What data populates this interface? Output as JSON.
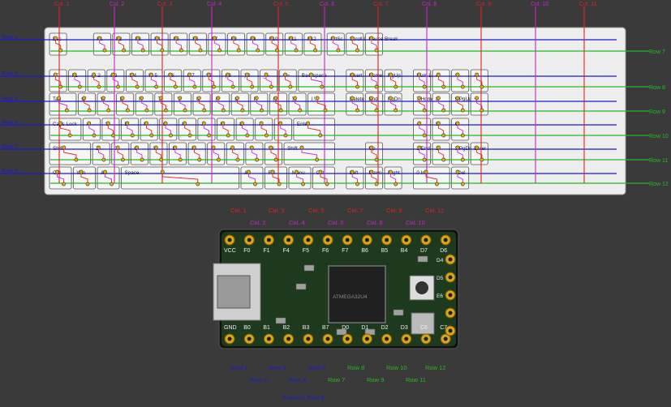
{
  "colors": {
    "background": "#3a3a3a",
    "red": "#e02020",
    "magenta": "#cc22cc",
    "blue": "#1a1acc",
    "green": "#22bb22",
    "keyboard_bg": "#eeeeee",
    "key_fill": "#f6f6f6",
    "key_border": "#555555",
    "pcb": "#111111",
    "pad_gold": "#d9a520"
  },
  "rows_left": [
    "Row 1",
    "Row 2",
    "Row 3",
    "Row 4",
    "Row 5",
    "Row 6"
  ],
  "rows_right": [
    "Row 7",
    "Row 8",
    "Row 9",
    "Row 10",
    "Row 11",
    "Row 12"
  ],
  "cols_top": [
    "Col. 1",
    "Col. 2",
    "Col. 3",
    "Col. 4",
    "Col. 5",
    "Col. 6",
    "Col. 7",
    "Col. 8",
    "Col. 9",
    "Col. 10",
    "Col. 11"
  ],
  "keys": [
    {
      "text": "Esc"
    },
    {
      "text": "F1"
    },
    {
      "text": "F2"
    },
    {
      "text": "F3"
    },
    {
      "text": "F4"
    },
    {
      "text": "F5"
    },
    {
      "text": "F6"
    },
    {
      "text": "F7"
    },
    {
      "text": "F8"
    },
    {
      "text": "F9"
    },
    {
      "text": "F10"
    },
    {
      "text": "F11"
    },
    {
      "text": "F12"
    },
    {
      "text": "PrtSc"
    },
    {
      "text": "Scroll Lock"
    },
    {
      "text": "Pause Break"
    },
    {
      "text": "~ `"
    },
    {
      "text": "! 1"
    },
    {
      "text": "@ 2"
    },
    {
      "text": "# 3"
    },
    {
      "text": "$ 4"
    },
    {
      "text": "% 5"
    },
    {
      "text": "^ 6"
    },
    {
      "text": "& 7"
    },
    {
      "text": "* 8"
    },
    {
      "text": "( 9"
    },
    {
      "text": ") 0"
    },
    {
      "text": "_ -"
    },
    {
      "text": "+ ="
    },
    {
      "text": "Backspace"
    },
    {
      "text": "Insert"
    },
    {
      "text": "Home"
    },
    {
      "text": "PgUp"
    },
    {
      "text": "Num Lock"
    },
    {
      "text": "/"
    },
    {
      "text": "*"
    },
    {
      "text": "-"
    },
    {
      "text": "Tab"
    },
    {
      "text": "Q"
    },
    {
      "text": "W"
    },
    {
      "text": "E"
    },
    {
      "text": "R"
    },
    {
      "text": "T"
    },
    {
      "text": "Y"
    },
    {
      "text": "U"
    },
    {
      "text": "I"
    },
    {
      "text": "O"
    },
    {
      "text": "P"
    },
    {
      "text": "{ ["
    },
    {
      "text": "} ]"
    },
    {
      "text": "| \\"
    },
    {
      "text": "Delete"
    },
    {
      "text": "End"
    },
    {
      "text": "PgDn"
    },
    {
      "text": "7 Home"
    },
    {
      "text": "8"
    },
    {
      "text": "9 PgUp"
    },
    {
      "text": "+"
    },
    {
      "text": "Caps Lock"
    },
    {
      "text": "A"
    },
    {
      "text": "S"
    },
    {
      "text": "D"
    },
    {
      "text": "F"
    },
    {
      "text": "G"
    },
    {
      "text": "H"
    },
    {
      "text": "J"
    },
    {
      "text": "K"
    },
    {
      "text": "L"
    },
    {
      "text": ": ;"
    },
    {
      "text": "\" '"
    },
    {
      "text": "Enter"
    },
    {
      "text": "4"
    },
    {
      "text": "5"
    },
    {
      "text": "6"
    },
    {
      "text": "Shift"
    },
    {
      "text": "Z"
    },
    {
      "text": "X"
    },
    {
      "text": "C"
    },
    {
      "text": "V"
    },
    {
      "text": "B"
    },
    {
      "text": "N"
    },
    {
      "text": "M"
    },
    {
      "text": "< ,"
    },
    {
      "text": "> ."
    },
    {
      "text": "? /"
    },
    {
      "text": "Shift"
    },
    {
      "text": "Up"
    },
    {
      "text": "1 End"
    },
    {
      "text": "2"
    },
    {
      "text": "3 PgDn"
    },
    {
      "text": "Enter"
    },
    {
      "text": "Ctrl"
    },
    {
      "text": "Win"
    },
    {
      "text": "Alt"
    },
    {
      "text": "Space"
    },
    {
      "text": "Alt"
    },
    {
      "text": "FN"
    },
    {
      "text": "Menu"
    },
    {
      "text": "Ctrl"
    },
    {
      "text": "Left"
    },
    {
      "text": "Down"
    },
    {
      "text": "Right"
    },
    {
      "text": "0 Ins"
    },
    {
      "text": ". Del"
    }
  ],
  "board": {
    "top_labels_line1": [
      "Col. 1",
      "Col. 3",
      "Col. 5",
      "Col. 7",
      "Col. 9",
      "Col. 11"
    ],
    "top_labels_line2": [
      "Col. 2",
      "Col. 4",
      "Col. 6",
      "Col. 8",
      "Col. 10"
    ],
    "top_pins": [
      "VCC",
      "F0",
      "F1",
      "F4",
      "F5",
      "F6",
      "F7",
      "B6",
      "B5",
      "B4",
      "D7",
      "D6"
    ],
    "bottom_pins": [
      "GND",
      "B0",
      "B1",
      "B2",
      "B3",
      "B7",
      "D0",
      "D1",
      "D2",
      "D3",
      "C6",
      "C7"
    ],
    "right_pins": [
      "D4",
      "D5",
      "E6"
    ],
    "chip_text": "ATMEGA32U4",
    "bottom_labels_line1": [
      "Row 1",
      "Row 3",
      "Row 5",
      "Row 8",
      "Row 10",
      "Row 12"
    ],
    "bottom_labels_line2": [
      "Row 2",
      "Row 4",
      "Row 7",
      "Row 9",
      "Row 11"
    ],
    "bottom_labels_line3": [
      "(Interior) Row 6"
    ]
  }
}
